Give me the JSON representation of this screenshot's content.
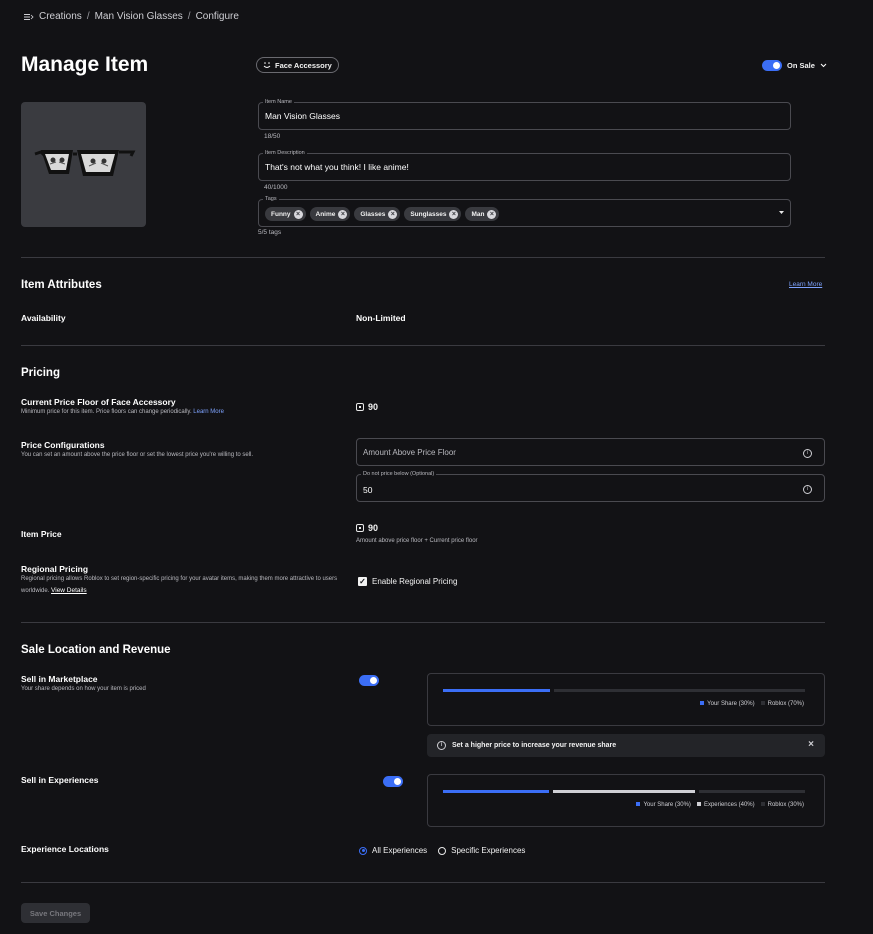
{
  "breadcrumb": {
    "items": [
      "Creations",
      "Man Vision Glasses",
      "Configure"
    ]
  },
  "header": {
    "title": "Manage Item",
    "category": "Face Accessory",
    "sale_status": "On Sale"
  },
  "item": {
    "name_label": "Item Name",
    "name": "Man Vision Glasses",
    "name_count": "18/50",
    "description_label": "Item Description",
    "description": "That's not what you think! I like anime!",
    "description_count": "40/1000",
    "tags_label": "Tags",
    "tags": [
      "Funny",
      "Anime",
      "Glasses",
      "Sunglasses",
      "Man"
    ],
    "tags_count": "5/5 tags"
  },
  "attributes": {
    "heading": "Item Attributes",
    "learn_more": "Learn More",
    "availability_label": "Availability",
    "availability_value": "Non-Limited"
  },
  "pricing": {
    "heading": "Pricing",
    "floor_label": "Current Price Floor of Face Accessory",
    "floor_desc": "Minimum price for this item. Price floors can change periodically.",
    "floor_link": "Learn More",
    "floor_value": "90",
    "config_label": "Price Configurations",
    "config_desc": "You can set an amount above the price floor or set the lowest price you're willing to sell.",
    "amount_placeholder": "Amount Above Price Floor",
    "min_label": "Do not price below (Optional)",
    "min_value": "50",
    "item_price_label": "Item Price",
    "item_price_value": "90",
    "item_price_note": "Amount above price floor + Current price floor",
    "regional_label": "Regional Pricing",
    "regional_desc": "Regional pricing allows Roblox to set region-specific pricing for your avatar items, making them more attractive to users worldwide.",
    "regional_link": "View Details",
    "regional_checkbox": "Enable Regional Pricing"
  },
  "sale": {
    "heading": "Sale Location and Revenue",
    "marketplace_label": "Sell in Marketplace",
    "marketplace_desc": "Your share depends on how your item is priced",
    "marketplace_legend": [
      "Your Share (30%)",
      "Roblox (70%)"
    ],
    "marketplace_share": [
      30,
      70
    ],
    "tip": "Set a higher price to increase your revenue share",
    "experiences_label": "Sell in Experiences",
    "experiences_legend": [
      "Your Share (30%)",
      "Experiences (40%)",
      "Roblox (30%)"
    ],
    "experiences_share": [
      30,
      40,
      30
    ],
    "locations_label": "Experience Locations",
    "location_all": "All Experiences",
    "location_specific": "Specific Experiences"
  },
  "footer": {
    "save": "Save Changes"
  },
  "colors": {
    "accent": "#3b6ef6",
    "background": "#121215"
  }
}
